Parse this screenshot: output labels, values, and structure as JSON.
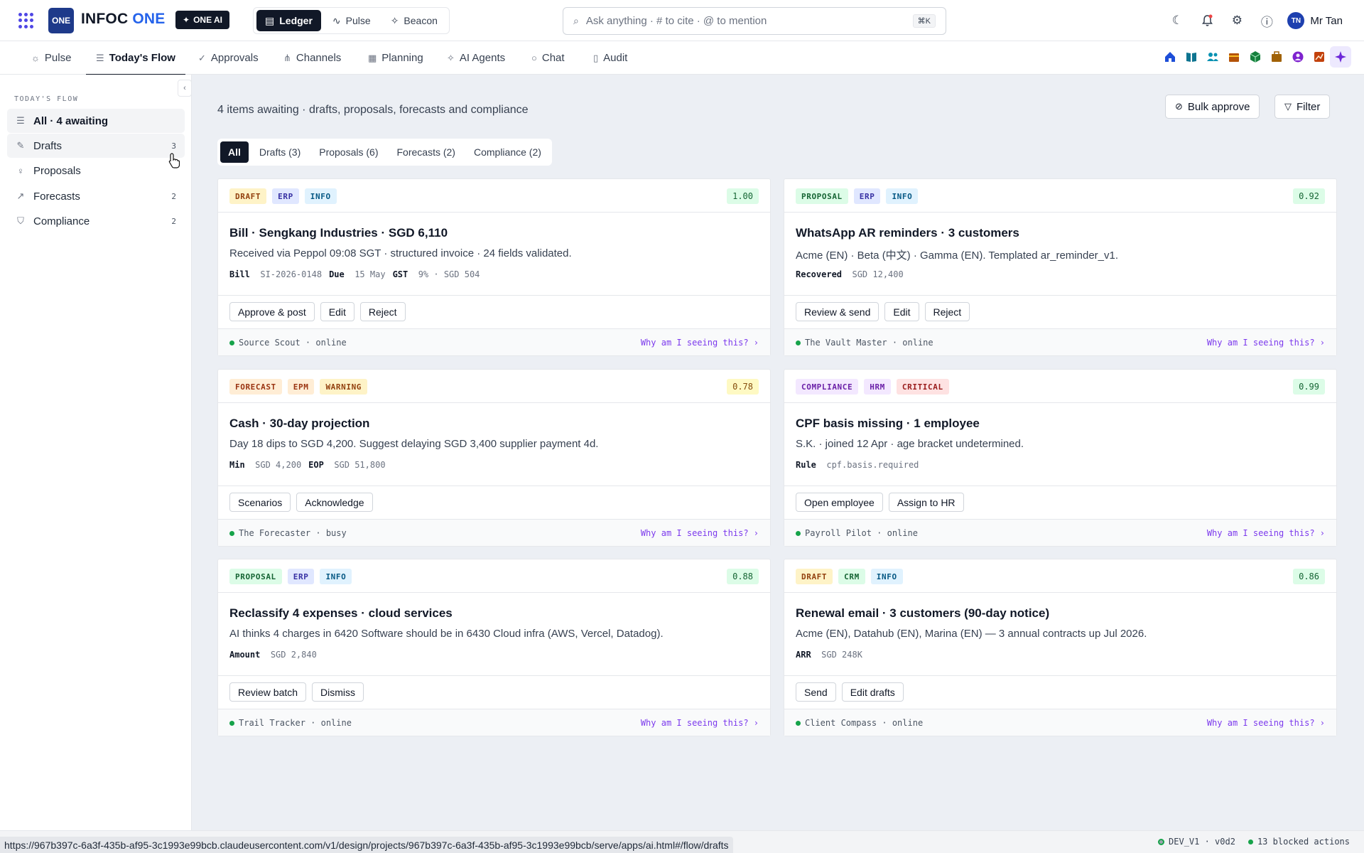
{
  "topbar": {
    "logo": "ONE",
    "brand_main": "INFOC",
    "brand_accent": "ONE",
    "oneai": "ONE AI",
    "modes": [
      {
        "label": "Ledger",
        "icon": "ledger-icon"
      },
      {
        "label": "Pulse",
        "icon": "pulse-icon"
      },
      {
        "label": "Beacon",
        "icon": "beacon-icon"
      }
    ],
    "search_placeholder": "Ask anything · # to cite · @ to mention",
    "search_shortcut": "⌘K",
    "user_initials": "TN",
    "user_name": "Mr Tan"
  },
  "tabs": [
    {
      "label": "Pulse",
      "icon": "pulse-icon"
    },
    {
      "label": "Today's Flow",
      "icon": "list-icon",
      "active": true
    },
    {
      "label": "Approvals",
      "icon": "check-circle-icon"
    },
    {
      "label": "Channels",
      "icon": "channels-icon"
    },
    {
      "label": "Planning",
      "icon": "calendar-icon"
    },
    {
      "label": "AI Agents",
      "icon": "sparkle-icon"
    },
    {
      "label": "Chat",
      "icon": "chat-icon"
    },
    {
      "label": "Audit",
      "icon": "document-icon"
    }
  ],
  "app_icons": [
    {
      "name": "home-app-icon",
      "color": "#1d4ed8"
    },
    {
      "name": "book-app-icon",
      "color": "#0e7490"
    },
    {
      "name": "people-app-icon",
      "color": "#0891b2"
    },
    {
      "name": "store-app-icon",
      "color": "#b45309"
    },
    {
      "name": "box-app-icon",
      "color": "#15803d"
    },
    {
      "name": "briefcase-app-icon",
      "color": "#a16207"
    },
    {
      "name": "user-app-icon",
      "color": "#7e22ce"
    },
    {
      "name": "chart-app-icon",
      "color": "#c2410c"
    },
    {
      "name": "ai-sparkle-app-icon",
      "color": "#6d28d9"
    }
  ],
  "sidebar": {
    "heading": "TODAY'S FLOW",
    "items": [
      {
        "label": "All · 4 awaiting",
        "count": "",
        "icon": "list-icon"
      },
      {
        "label": "Drafts",
        "count": "3",
        "icon": "pencil-icon"
      },
      {
        "label": "Proposals",
        "count": "",
        "icon": "lightbulb-icon"
      },
      {
        "label": "Forecasts",
        "count": "2",
        "icon": "trend-icon"
      },
      {
        "label": "Compliance",
        "count": "2",
        "icon": "shield-icon"
      }
    ]
  },
  "main": {
    "summary": "4 items awaiting · drafts, proposals, forecasts and compliance",
    "bulk_approve": "Bulk approve",
    "filter": "Filter",
    "filter_chips": [
      "All",
      "Drafts (3)",
      "Proposals (6)",
      "Forecasts (2)",
      "Compliance (2)"
    ]
  },
  "cards": [
    {
      "tags": [
        {
          "label": "DRAFT",
          "kind": "draft"
        },
        {
          "label": "ERP",
          "kind": "erp"
        },
        {
          "label": "INFO",
          "kind": "info"
        }
      ],
      "score": "1.00",
      "score_kind": "green",
      "title": "Bill · Sengkang Industries · SGD 6,110",
      "desc": "Received via Peppol 09:08 SGT · structured invoice · 24 fields validated.",
      "meta": [
        {
          "k": "Bill",
          "v": "SI-2026-0148"
        },
        {
          "k": "Due",
          "v": "15 May"
        },
        {
          "k": "GST",
          "v": "9% · SGD 504"
        }
      ],
      "actions": [
        "Approve & post",
        "Edit",
        "Reject"
      ],
      "agent": "Source Scout · online",
      "why": "Why am I seeing this? ›"
    },
    {
      "tags": [
        {
          "label": "PROPOSAL",
          "kind": "proposal"
        },
        {
          "label": "ERP",
          "kind": "erp"
        },
        {
          "label": "INFO",
          "kind": "info"
        }
      ],
      "score": "0.92",
      "score_kind": "green",
      "title": "WhatsApp AR reminders · 3 customers",
      "desc": "Acme (EN) · Beta (中文) · Gamma (EN). Templated ar_reminder_v1.",
      "meta": [
        {
          "k": "Recovered",
          "v": "SGD 12,400"
        }
      ],
      "actions": [
        "Review & send",
        "Edit",
        "Reject"
      ],
      "agent": "The Vault Master · online",
      "why": "Why am I seeing this? ›"
    },
    {
      "tags": [
        {
          "label": "FORECAST",
          "kind": "forecast"
        },
        {
          "label": "EPM",
          "kind": "epm"
        },
        {
          "label": "WARNING",
          "kind": "warning"
        }
      ],
      "score": "0.78",
      "score_kind": "yellow",
      "title": "Cash · 30-day projection",
      "desc": "Day 18 dips to SGD 4,200. Suggest delaying SGD 3,400 supplier payment 4d.",
      "meta": [
        {
          "k": "Min",
          "v": "SGD 4,200"
        },
        {
          "k": "EOP",
          "v": "SGD 51,800"
        }
      ],
      "actions": [
        "Scenarios",
        "Acknowledge"
      ],
      "agent": "The Forecaster · busy",
      "why": "Why am I seeing this? ›"
    },
    {
      "tags": [
        {
          "label": "COMPLIANCE",
          "kind": "compliance"
        },
        {
          "label": "HRM",
          "kind": "hrm"
        },
        {
          "label": "CRITICAL",
          "kind": "critical"
        }
      ],
      "score": "0.99",
      "score_kind": "green",
      "title": "CPF basis missing · 1 employee",
      "desc": "S.K. · joined 12 Apr · age bracket undetermined.",
      "meta": [
        {
          "k": "Rule",
          "v": "cpf.basis.required"
        }
      ],
      "actions": [
        "Open employee",
        "Assign to HR"
      ],
      "agent": "Payroll Pilot · online",
      "why": "Why am I seeing this? ›"
    },
    {
      "tags": [
        {
          "label": "PROPOSAL",
          "kind": "proposal"
        },
        {
          "label": "ERP",
          "kind": "erp"
        },
        {
          "label": "INFO",
          "kind": "info"
        }
      ],
      "score": "0.88",
      "score_kind": "green",
      "title": "Reclassify 4 expenses · cloud services",
      "desc": "AI thinks 4 charges in 6420 Software should be in 6430 Cloud infra (AWS, Vercel, Datadog).",
      "meta": [
        {
          "k": "Amount",
          "v": "SGD 2,840"
        }
      ],
      "actions": [
        "Review batch",
        "Dismiss"
      ],
      "agent": "Trail Tracker · online",
      "why": "Why am I seeing this? ›"
    },
    {
      "tags": [
        {
          "label": "DRAFT",
          "kind": "draft"
        },
        {
          "label": "CRM",
          "kind": "crm"
        },
        {
          "label": "INFO",
          "kind": "info"
        }
      ],
      "score": "0.86",
      "score_kind": "green",
      "title": "Renewal email · 3 customers (90-day notice)",
      "desc": "Acme (EN), Datahub (EN), Marina (EN) — 3 annual contracts up Jul 2026.",
      "meta": [
        {
          "k": "ARR",
          "v": "SGD 248K"
        }
      ],
      "actions": [
        "Send",
        "Edit drafts"
      ],
      "agent": "Client Compass · online",
      "why": "Why am I seeing this? ›"
    }
  ],
  "statusbar": {
    "url": "https://967b397c-6a3f-435b-af95-3c1993e99bcb.claudeusercontent.com/v1/design/projects/967b397c-6a3f-435b-af95-3c1993e99bcb/serve/apps/ai.html#/flow/drafts",
    "env": "DEV_V1 · v0d2",
    "blocked": "13 blocked actions"
  }
}
